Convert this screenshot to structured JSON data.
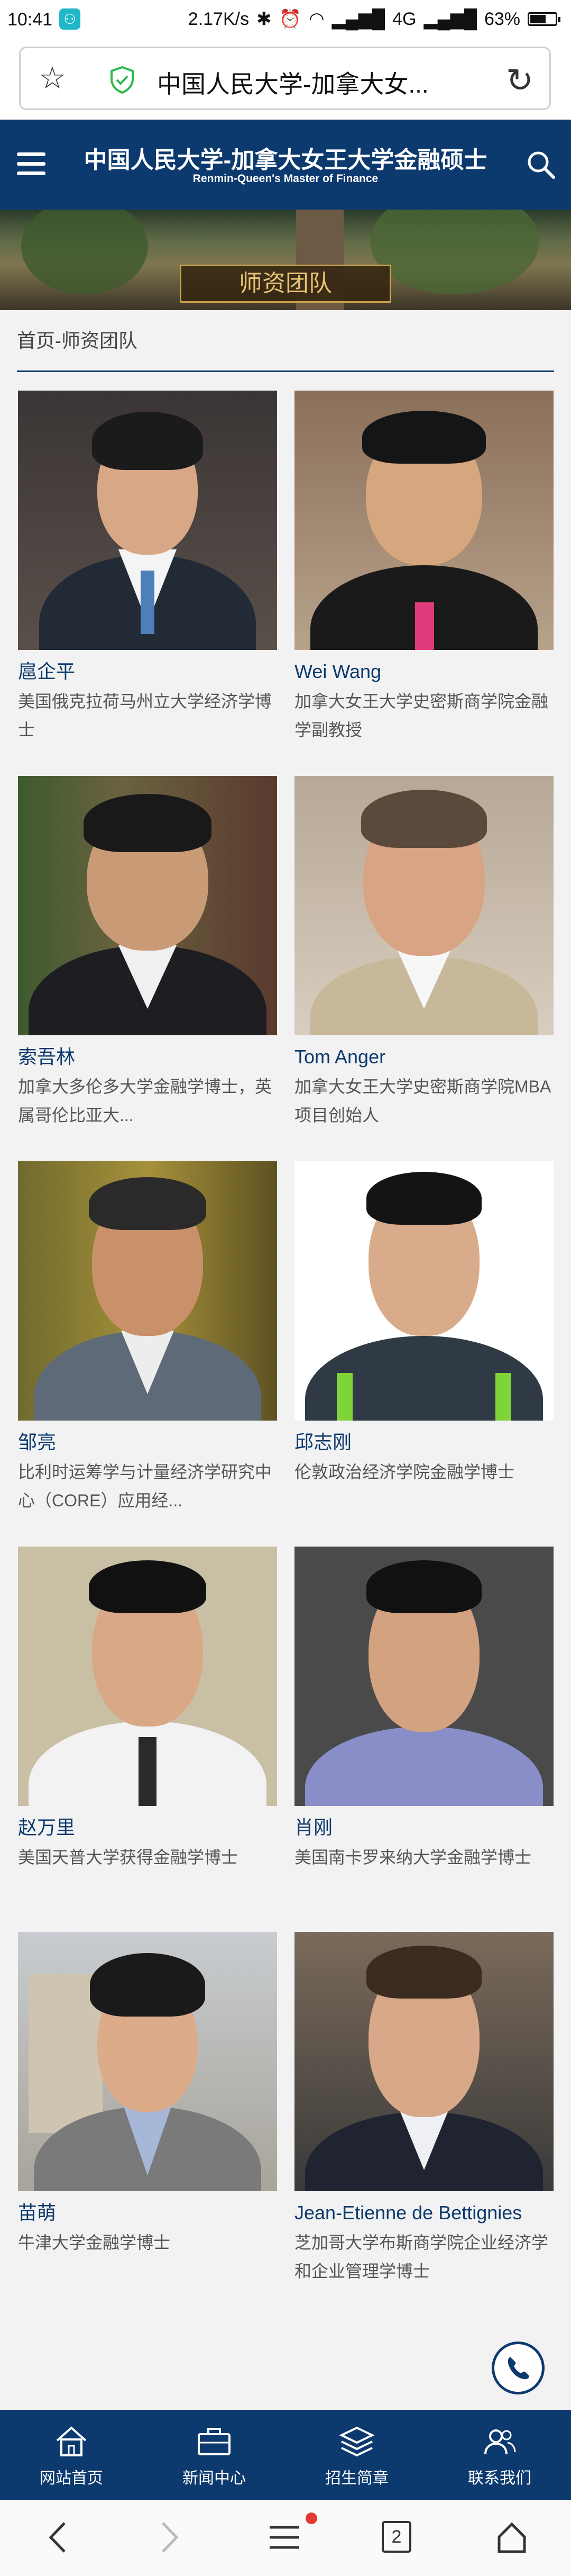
{
  "status_bar": {
    "time": "10:41",
    "speed": "2.17K/s",
    "network": "4G",
    "battery": "63%",
    "battery_level": 0.63
  },
  "browser": {
    "url_text": "中国人民大学-加拿大女..."
  },
  "header": {
    "title": "中国人民大学-加拿大女王大学金融硕士",
    "subtitle": "Renmin-Queen's Master of Finance"
  },
  "banner": {
    "label": "师资团队"
  },
  "breadcrumb": "首页-师资团队",
  "faculty": [
    {
      "name": "扈企平",
      "desc": "美国俄克拉荷马州立大学经济学博士"
    },
    {
      "name": "Wei Wang",
      "desc": "加拿大女王大学史密斯商学院金融学副教授"
    },
    {
      "name": "索吾林",
      "desc": "加拿大多伦多大学金融学博士，英属哥伦比亚大..."
    },
    {
      "name": "Tom Anger",
      "desc": "加拿大女王大学史密斯商学院MBA项目创始人"
    },
    {
      "name": "邹亮",
      "desc": "比利时运筹学与计量经济学研究中心（CORE）应用经..."
    },
    {
      "name": "邱志刚",
      "desc": "伦敦政治经济学院金融学博士"
    },
    {
      "name": "赵万里",
      "desc": "美国天普大学获得金融学博士"
    },
    {
      "name": "肖刚",
      "desc": "美国南卡罗来纳大学金融学博士"
    },
    {
      "name": "苗萌",
      "desc": "牛津大学金融学博士"
    },
    {
      "name": "Jean-Etienne de Bettignies",
      "desc": "芝加哥大学布斯商学院企业经济学和企业管理学博士"
    }
  ],
  "bottom_nav": [
    {
      "label": "网站首页",
      "icon": "home-icon"
    },
    {
      "label": "新闻中心",
      "icon": "briefcase-icon"
    },
    {
      "label": "招生简章",
      "icon": "layers-icon"
    },
    {
      "label": "联系我们",
      "icon": "contacts-icon"
    }
  ],
  "system_nav": {
    "tab_count": "2"
  },
  "colors": {
    "brand": "#0d3a6e",
    "accent_gold": "#e8c474"
  }
}
